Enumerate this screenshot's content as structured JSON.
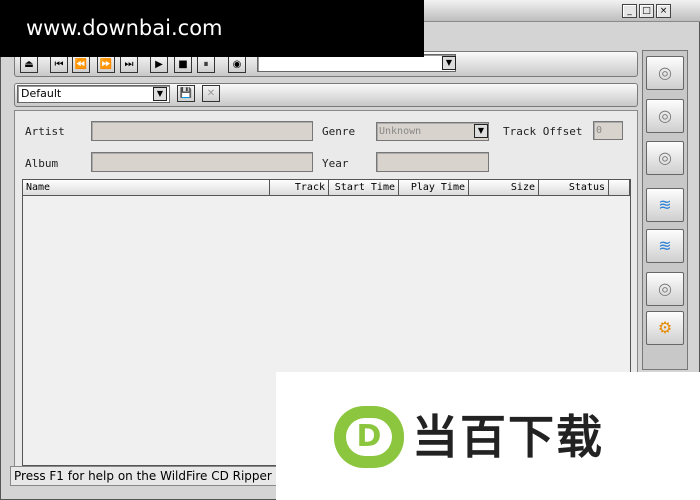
{
  "watermark": "www.downbai.com",
  "window_controls": {
    "minimize": "_",
    "restore": "□",
    "close": "×"
  },
  "toolbar": {
    "eject": "⏏",
    "prev": "⏮",
    "rewind": "⏪",
    "fast_forward": "⏩",
    "next": "⏭",
    "play": "▶",
    "stop": "■",
    "pause": "⏸",
    "cd_icon": "◉",
    "drive_select_value": "",
    "dropdown": "▼"
  },
  "profile": {
    "value": "Default",
    "dropdown": "▼",
    "save": "💾",
    "delete": "✕"
  },
  "form": {
    "artist_label": "Artist",
    "album_label": "Album",
    "genre_label": "Genre",
    "genre_value": "Unknown",
    "year_label": "Year",
    "track_offset_label": "Track Offset",
    "track_offset_value": "0"
  },
  "table": {
    "columns": [
      "Name",
      "Track",
      "Start Time",
      "Play Time",
      "Size",
      "Status"
    ]
  },
  "sidebar": {
    "icons": [
      "◎",
      "◎",
      "◎",
      "≋",
      "≋",
      "◎",
      "⚙"
    ]
  },
  "status_text": "Press F1 for help on the WildFire CD Ripper a",
  "ad": {
    "logo_letter": "D",
    "text": "当百下载"
  },
  "colors": {
    "accent": "#8cc63f"
  }
}
